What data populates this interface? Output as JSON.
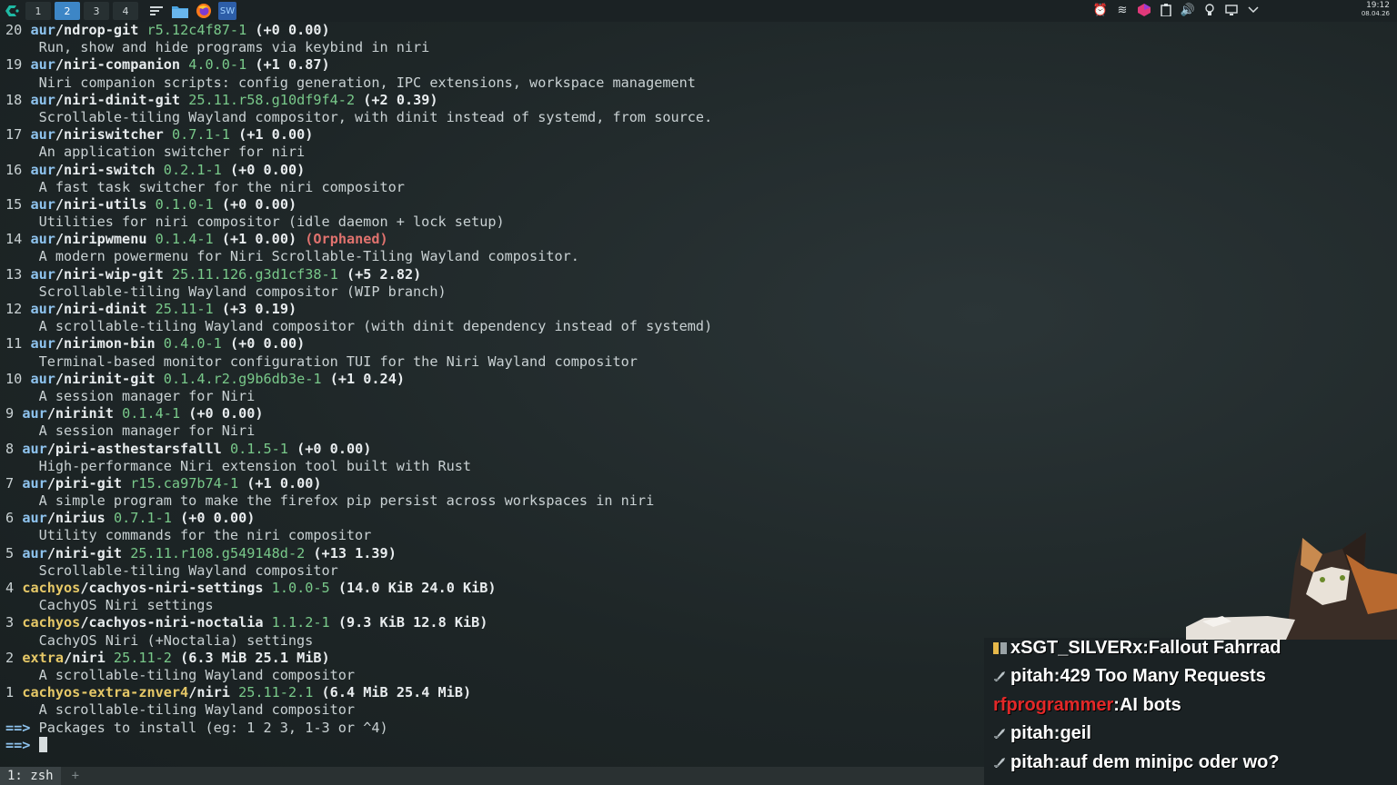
{
  "topbar": {
    "workspaces": [
      "1",
      "2",
      "3",
      "4"
    ],
    "active_workspace": "2",
    "clock_time": "19:12",
    "clock_date": "08.04.26",
    "icons": [
      "cachyos-logo-icon",
      "kde-menu-icon",
      "file-manager-icon",
      "firefox-icon",
      "sw-app-icon"
    ],
    "tray_icons": [
      "notification-icon",
      "network-icon",
      "color-app-icon",
      "clipboard-icon",
      "volume-icon",
      "lightbulb-icon",
      "display-icon",
      "expand-icon"
    ],
    "colors": {
      "active_workspace": "#3d86c6"
    }
  },
  "terminal": {
    "results": [
      {
        "num": "20",
        "repo": "aur",
        "name": "ndrop-git",
        "version": "r5.12c4f87-1",
        "status": "(+0 0.00)",
        "desc": "Run, show and hide programs via keybind in niri"
      },
      {
        "num": "19",
        "repo": "aur",
        "name": "niri-companion",
        "version": "4.0.0-1",
        "status": "(+1 0.87)",
        "desc": "Niri companion scripts: config generation, IPC extensions, workspace management"
      },
      {
        "num": "18",
        "repo": "aur",
        "name": "niri-dinit-git",
        "version": "25.11.r58.g10df9f4-2",
        "status": "(+2 0.39)",
        "desc": "Scrollable-tiling Wayland compositor, with dinit instead of systemd, from source."
      },
      {
        "num": "17",
        "repo": "aur",
        "name": "niriswitcher",
        "version": "0.7.1-1",
        "status": "(+1 0.00)",
        "desc": "An application switcher for niri"
      },
      {
        "num": "16",
        "repo": "aur",
        "name": "niri-switch",
        "version": "0.2.1-1",
        "status": "(+0 0.00)",
        "desc": "A fast task switcher for the niri compositor"
      },
      {
        "num": "15",
        "repo": "aur",
        "name": "niri-utils",
        "version": "0.1.0-1",
        "status": "(+0 0.00)",
        "desc": "Utilities for niri compositor (idle daemon + lock setup)"
      },
      {
        "num": "14",
        "repo": "aur",
        "name": "niripwmenu",
        "version": "0.1.4-1",
        "status": "(+1 0.00)",
        "flag": "(Orphaned)",
        "desc": "A modern powermenu for Niri Scrollable-Tiling Wayland compositor."
      },
      {
        "num": "13",
        "repo": "aur",
        "name": "niri-wip-git",
        "version": "25.11.126.g3d1cf38-1",
        "status": "(+5 2.82)",
        "desc": "Scrollable-tiling Wayland compositor (WIP branch)"
      },
      {
        "num": "12",
        "repo": "aur",
        "name": "niri-dinit",
        "version": "25.11-1",
        "status": "(+3 0.19)",
        "desc": "A scrollable-tiling Wayland compositor (with dinit dependency instead of systemd)"
      },
      {
        "num": "11",
        "repo": "aur",
        "name": "nirimon-bin",
        "version": "0.4.0-1",
        "status": "(+0 0.00)",
        "desc": "Terminal-based monitor configuration TUI for the Niri Wayland compositor"
      },
      {
        "num": "10",
        "repo": "aur",
        "name": "nirinit-git",
        "version": "0.1.4.r2.g9b6db3e-1",
        "status": "(+1 0.24)",
        "desc": "A session manager for Niri"
      },
      {
        "num": "9",
        "repo": "aur",
        "name": "nirinit",
        "version": "0.1.4-1",
        "status": "(+0 0.00)",
        "desc": "A session manager for Niri"
      },
      {
        "num": "8",
        "repo": "aur",
        "name": "piri-asthestarsfalll",
        "version": "0.1.5-1",
        "status": "(+0 0.00)",
        "desc": "High-performance Niri extension tool built with Rust"
      },
      {
        "num": "7",
        "repo": "aur",
        "name": "piri-git",
        "version": "r15.ca97b74-1",
        "status": "(+1 0.00)",
        "desc": "A simple program to make the firefox pip persist across workspaces in niri"
      },
      {
        "num": "6",
        "repo": "aur",
        "name": "nirius",
        "version": "0.7.1-1",
        "status": "(+0 0.00)",
        "desc": "Utility commands for the niri compositor"
      },
      {
        "num": "5",
        "repo": "aur",
        "name": "niri-git",
        "version": "25.11.r108.g549148d-2",
        "status": "(+13 1.39)",
        "desc": "Scrollable-tiling Wayland compositor"
      },
      {
        "num": "4",
        "repo": "cachyos",
        "name": "cachyos-niri-settings",
        "version": "1.0.0-5",
        "status": "(14.0 KiB 24.0 KiB)",
        "desc": "CachyOS Niri settings"
      },
      {
        "num": "3",
        "repo": "cachyos",
        "name": "cachyos-niri-noctalia",
        "version": "1.1.2-1",
        "status": "(9.3 KiB 12.8 KiB)",
        "desc": "CachyOS Niri (+Noctalia) settings"
      },
      {
        "num": "2",
        "repo": "extra",
        "name": "niri",
        "version": "25.11-2",
        "status": "(6.3 MiB 25.1 MiB)",
        "desc": "A scrollable-tiling Wayland compositor"
      },
      {
        "num": "1",
        "repo": "cachyos-extra-znver4",
        "name": "niri",
        "version": "25.11-2.1",
        "status": "(6.4 MiB 25.4 MiB)",
        "desc": "A scrollable-tiling Wayland compositor"
      }
    ],
    "prompt_marker": "==>",
    "install_prompt": "Packages to install (eg: 1 2 3, 1-3 or ^4)",
    "colors": {
      "repo_aur": "#8ec3ee",
      "repo_other": "#e6c867",
      "version": "#79c98a",
      "orphaned": "#e0726e"
    }
  },
  "tabbar": {
    "tab_label": "1: zsh",
    "add_label": "+"
  },
  "chat": {
    "messages": [
      {
        "user": "xSGT_SILVERx",
        "text": "Fallout Fahrrad",
        "badge": "badge-icon",
        "highlight": false
      },
      {
        "user": "pitah",
        "text": "429 Too Many Requests",
        "badge": "mod-sword-icon",
        "highlight": false
      },
      {
        "user": "rfprogrammer",
        "text": "AI bots",
        "badge": "",
        "highlight": true
      },
      {
        "user": "pitah",
        "text": "geil",
        "badge": "mod-sword-icon",
        "highlight": false
      },
      {
        "user": "pitah",
        "text": "auf dem minipc oder wo?",
        "badge": "mod-sword-icon",
        "highlight": false
      }
    ]
  }
}
